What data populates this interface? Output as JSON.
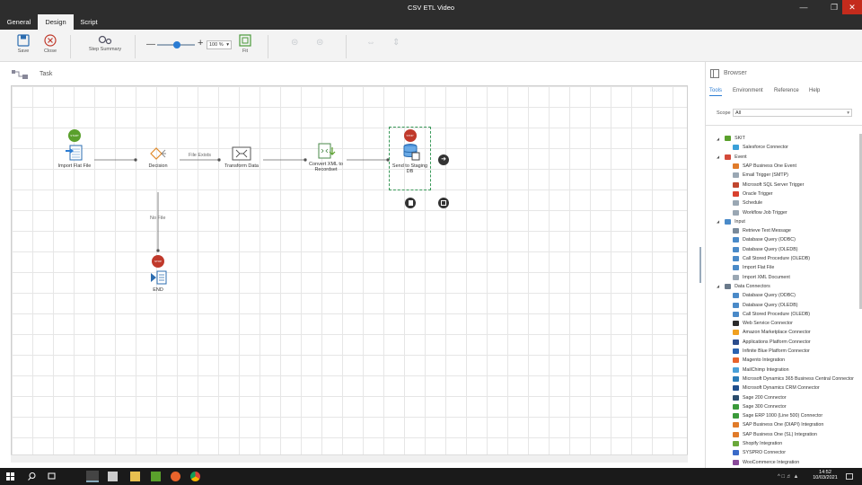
{
  "window": {
    "title": "CSV ETL Video"
  },
  "tabs": [
    {
      "label": "General"
    },
    {
      "label": "Design"
    },
    {
      "label": "Script"
    }
  ],
  "ribbon": {
    "save": "Save",
    "close": "Close",
    "step_summary": "Step Summary",
    "zoom": "100 %",
    "fit": "Fit"
  },
  "task": {
    "label": "Task"
  },
  "nodes": {
    "import_flat_file": "Import Flat File",
    "decision": "Decision",
    "transform_data": "Transform Data",
    "convert_xml": "Convert XML to Recordset",
    "send_staging": "Send to Staging DB",
    "end": "END"
  },
  "edge_labels": {
    "file_exists": "File Exists",
    "no_file": "No File"
  },
  "badges": {
    "start": "START",
    "stop": "STOP"
  },
  "browser": {
    "title": "Browser",
    "tabs": [
      "Tools",
      "Environment",
      "Reference",
      "Help"
    ],
    "scope_label": "Scope",
    "scope_value": "All",
    "tree": [
      {
        "label": "SKIT",
        "group": true,
        "color": "#5aa02c"
      },
      {
        "label": "Salesforce Connector",
        "color": "#3aa0d8"
      },
      {
        "label": "Event",
        "group": true,
        "color": "#d34a3a"
      },
      {
        "label": "SAP Business One Event",
        "color": "#e07b2a"
      },
      {
        "label": "Email Trigger (SMTP)",
        "color": "#9aa7b3"
      },
      {
        "label": "Microsoft SQL Server Trigger",
        "color": "#c0462e"
      },
      {
        "label": "Oracle Trigger",
        "color": "#d9412e"
      },
      {
        "label": "Schedule",
        "color": "#9aa7b3"
      },
      {
        "label": "Workflow Job Trigger",
        "color": "#9aa7b3"
      },
      {
        "label": "Input",
        "group": true,
        "color": "#4a8ac8"
      },
      {
        "label": "Retrieve Text Message",
        "color": "#7a8a9a"
      },
      {
        "label": "Database Query (ODBC)",
        "color": "#4a8ac8"
      },
      {
        "label": "Database Query (OLEDB)",
        "color": "#4a8ac8"
      },
      {
        "label": "Call Stored Procedure (OLEDB)",
        "color": "#4a8ac8"
      },
      {
        "label": "Import Flat File",
        "color": "#4a8ac8"
      },
      {
        "label": "Import XML Document",
        "color": "#9aa7b3"
      },
      {
        "label": "Data Connectors",
        "group": true,
        "color": "#6a7a8a"
      },
      {
        "label": "Database Query (ODBC)",
        "color": "#4a8ac8"
      },
      {
        "label": "Database Query (OLEDB)",
        "color": "#4a8ac8"
      },
      {
        "label": "Call Stored Procedure (OLEDB)",
        "color": "#4a8ac8"
      },
      {
        "label": "Web Service Connector",
        "color": "#2b2b2b"
      },
      {
        "label": "Amazon Marketplace Connector",
        "color": "#f0a020"
      },
      {
        "label": "Applications Platform Connector",
        "color": "#2b4c8c"
      },
      {
        "label": "Infinite Blue Platform Connector",
        "color": "#2a62b0"
      },
      {
        "label": "Magento Integration",
        "color": "#e8632b"
      },
      {
        "label": "MailChimp Integration",
        "color": "#4aa0d8"
      },
      {
        "label": "Microsoft Dynamics 365 Business Central Connector",
        "color": "#2b7cb8"
      },
      {
        "label": "Microsoft Dynamics CRM Connector",
        "color": "#1f4e8c"
      },
      {
        "label": "Sage 200 Connector",
        "color": "#2b4c6c"
      },
      {
        "label": "Sage 300 Connector",
        "color": "#3a9a3a"
      },
      {
        "label": "Sage ERP 1000 (Line 500) Connector",
        "color": "#3a9a3a"
      },
      {
        "label": "SAP Business One (DIAPI) Integration",
        "color": "#e07b2a"
      },
      {
        "label": "SAP Business One (SL) Integration",
        "color": "#e07b2a"
      },
      {
        "label": "Shopify Integration",
        "color": "#6aa83a"
      },
      {
        "label": "SYSPRO Connector",
        "color": "#3a6ac8"
      },
      {
        "label": "WooCommerce Integration",
        "color": "#8a4a9a"
      }
    ]
  },
  "taskbar": {
    "time": "14:52",
    "date": "10/03/2021"
  },
  "colors": {
    "chrome": "#2d2d2d",
    "accent": "#2b7cd3",
    "start_badge": "#5aa02c",
    "stop_badge": "#c0392b"
  }
}
